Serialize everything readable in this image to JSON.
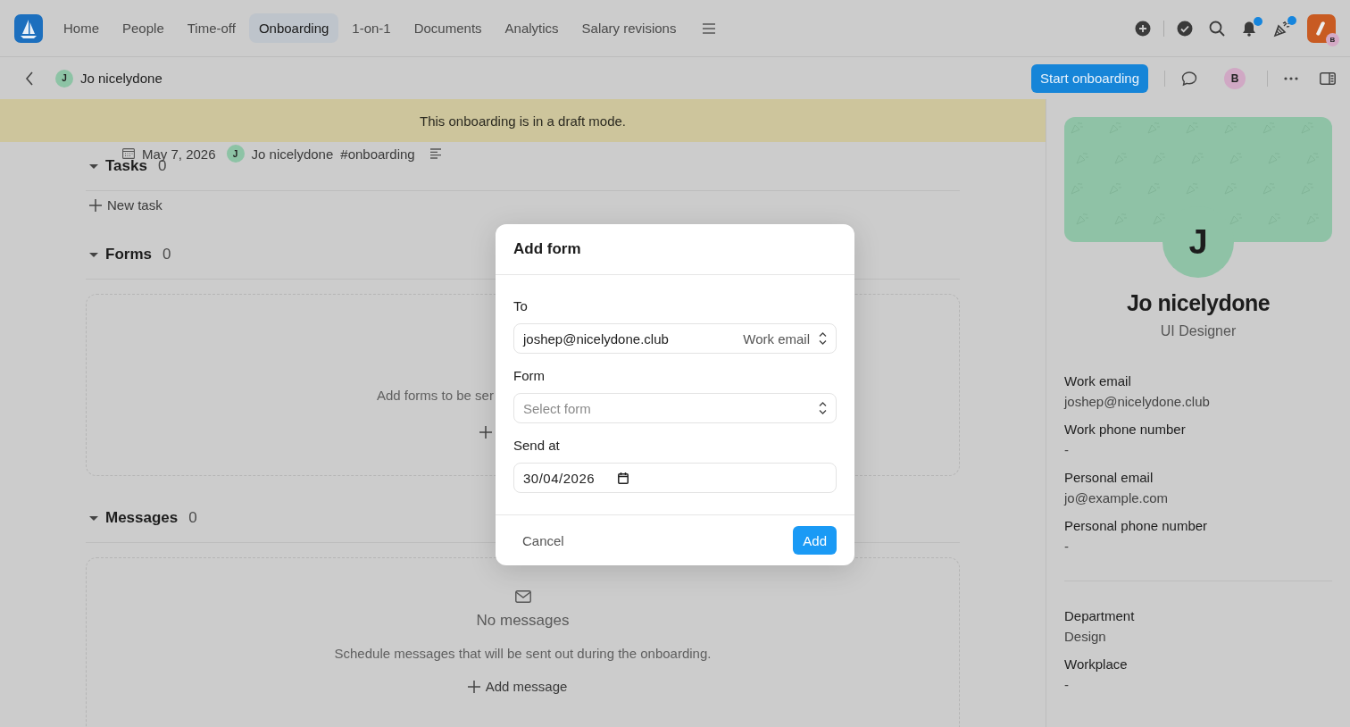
{
  "nav": {
    "tabs": [
      {
        "label": "Home",
        "selected": false
      },
      {
        "label": "People",
        "selected": false
      },
      {
        "label": "Time-off",
        "selected": false
      },
      {
        "label": "Onboarding",
        "selected": true
      },
      {
        "label": "1-on-1",
        "selected": false
      },
      {
        "label": "Documents",
        "selected": false
      },
      {
        "label": "Analytics",
        "selected": false
      },
      {
        "label": "Salary revisions",
        "selected": false
      }
    ],
    "alerts": [
      {
        "kind": "bell",
        "unread": true
      },
      {
        "kind": "party",
        "unread": true
      }
    ],
    "account_badge": "B"
  },
  "header": {
    "avatar": "J",
    "name": "Jo nicelydone",
    "button": "Start onboarding",
    "user_avatar": "B"
  },
  "banner": "This onboarding is in a draft mode.",
  "meta": {
    "date": "May 7, 2026",
    "avatar": "J",
    "name": "Jo nicelydone",
    "tag": "#onboarding"
  },
  "sections": [
    {
      "kind": "list",
      "title": "Tasks",
      "count": "0",
      "expanded": true,
      "action": "New task"
    },
    {
      "kind": "empty",
      "title": "Forms",
      "count": "0",
      "expanded": true,
      "empty_text": "Add forms to be ser"
    },
    {
      "kind": "empty",
      "title": "Messages",
      "count": "0",
      "expanded": true,
      "empty_title": "No messages",
      "empty_text": "Schedule messages that will be sent out during the onboarding.",
      "action": "Add message"
    }
  ],
  "profile": {
    "initial": "J",
    "name": "Jo nicelydone",
    "role": "UI Designer",
    "groups": [
      [
        {
          "label": "Work email",
          "value": "joshep@nicelydone.club"
        },
        {
          "label": "Work phone number",
          "value": "-"
        },
        {
          "label": "Personal email",
          "value": "jo@example.com"
        },
        {
          "label": "Personal phone number",
          "value": "-"
        }
      ],
      [
        {
          "label": "Department",
          "value": "Design"
        },
        {
          "label": "Workplace",
          "value": "-"
        }
      ]
    ]
  },
  "modal": {
    "title": "Add form",
    "fields": [
      {
        "kind": "select",
        "label": "To",
        "value": "joshep@nicelydone.club",
        "suffix": "Work email"
      },
      {
        "kind": "select",
        "label": "Form",
        "placeholder": "Select form"
      },
      {
        "kind": "date",
        "label": "Send at",
        "value": "30/04/2026"
      }
    ],
    "cancel": "Cancel",
    "submit": "Add"
  }
}
